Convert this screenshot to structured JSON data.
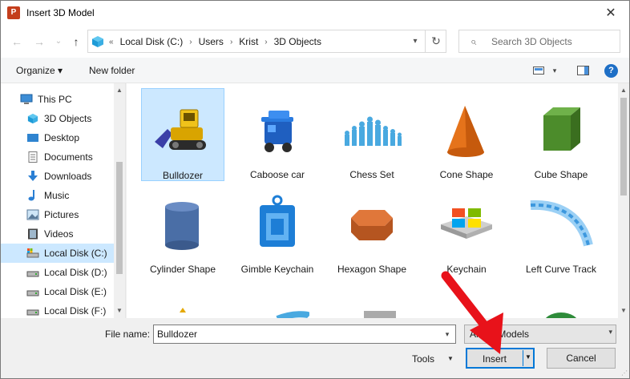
{
  "window": {
    "title": "Insert 3D Model",
    "app_icon": "P"
  },
  "nav": {
    "back_icon": "←",
    "forward_icon": "→",
    "recent_icon": "⌄",
    "up_icon": "↑",
    "breadcrumbs": [
      "Local Disk (C:)",
      "Users",
      "Krist",
      "3D Objects"
    ],
    "search_placeholder": "Search 3D Objects"
  },
  "toolbar": {
    "organize": "Organize ▾",
    "new_folder": "New folder"
  },
  "sidebar": {
    "items": [
      {
        "label": "This PC",
        "icon": "computer-icon"
      },
      {
        "label": "3D Objects",
        "icon": "cube-icon"
      },
      {
        "label": "Desktop",
        "icon": "desktop-icon"
      },
      {
        "label": "Documents",
        "icon": "document-icon"
      },
      {
        "label": "Downloads",
        "icon": "download-icon"
      },
      {
        "label": "Music",
        "icon": "music-icon"
      },
      {
        "label": "Pictures",
        "icon": "pictures-icon"
      },
      {
        "label": "Videos",
        "icon": "video-icon"
      },
      {
        "label": "Local Disk (C:)",
        "icon": "drive-icon",
        "selected": true
      },
      {
        "label": "Local Disk (D:)",
        "icon": "drive-icon"
      },
      {
        "label": "Local Disk (E:)",
        "icon": "drive-icon"
      },
      {
        "label": "Local Disk (F:)",
        "icon": "drive-icon"
      }
    ]
  },
  "files": [
    {
      "label": "Bulldozer",
      "selected": true
    },
    {
      "label": "Caboose car"
    },
    {
      "label": "Chess Set"
    },
    {
      "label": "Cone Shape"
    },
    {
      "label": "Cube Shape"
    },
    {
      "label": "Cylinder Shape"
    },
    {
      "label": "Gimble Keychain"
    },
    {
      "label": "Hexagon Shape"
    },
    {
      "label": "Keychain"
    },
    {
      "label": "Left Curve Track"
    }
  ],
  "footer": {
    "file_name_label": "File name:",
    "file_name_value": "Bulldozer",
    "filter_value": "All 3D Models",
    "tools_label": "Tools",
    "insert_label": "Insert",
    "cancel_label": "Cancel"
  },
  "colors": {
    "selection": "#cce8ff",
    "accent": "#0078d7",
    "annotation": "#e8121a"
  }
}
